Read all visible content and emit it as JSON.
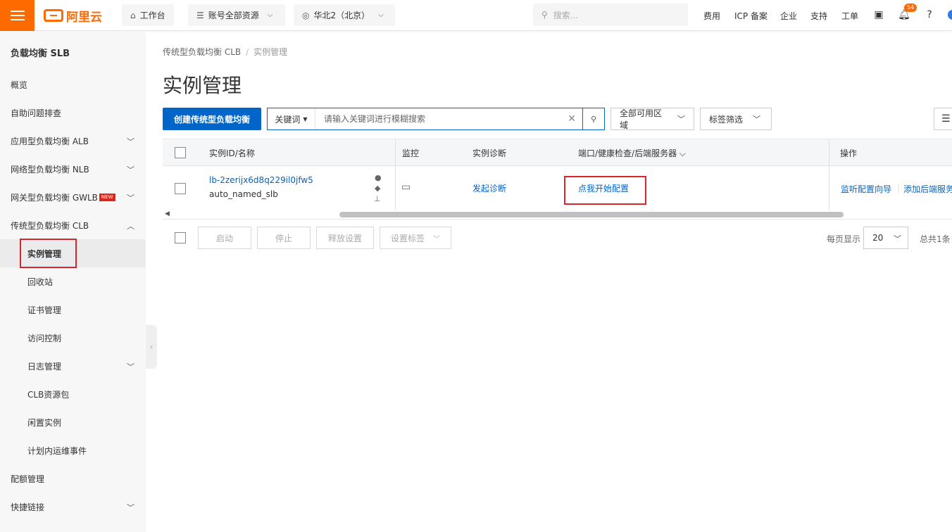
{
  "topbar": {
    "logo_text": "阿里云",
    "workbench": "工作台",
    "account_resources": "账号全部资源",
    "region": "华北2（北京）",
    "search_placeholder": "搜索...",
    "links": [
      "费用",
      "ICP 备案",
      "企业",
      "支持",
      "工单"
    ],
    "notification_count": "54"
  },
  "sidebar": {
    "title": "负载均衡 SLB",
    "items": [
      {
        "label": "概览"
      },
      {
        "label": "自助问题排查"
      },
      {
        "label": "应用型负载均衡 ALB"
      },
      {
        "label": "网络型负载均衡 NLB"
      },
      {
        "label": "网关型负载均衡 GWLB",
        "badge": "NEW"
      },
      {
        "label": "传统型负载均衡 CLB"
      },
      {
        "label": "实例管理"
      },
      {
        "label": "回收站"
      },
      {
        "label": "证书管理"
      },
      {
        "label": "访问控制"
      },
      {
        "label": "日志管理"
      },
      {
        "label": "CLB资源包"
      },
      {
        "label": "闲置实例"
      },
      {
        "label": "计划内运维事件"
      },
      {
        "label": "配额管理"
      },
      {
        "label": "快捷链接"
      }
    ]
  },
  "breadcrumb": [
    "传统型负载均衡 CLB",
    "实例管理"
  ],
  "page_title": "实例管理",
  "toolbar": {
    "create_button": "创建传统型负载均衡",
    "keyword_label": "关键词",
    "search_placeholder": "请输入关键词进行模糊搜索",
    "zone_filter": "全部可用区域",
    "tag_filter": "标签筛选"
  },
  "table": {
    "headers": [
      "实例ID/名称",
      "监控",
      "实例诊断",
      "端口/健康检查/后端服务器",
      "操作"
    ],
    "rows": [
      {
        "instance_id": "lb-2zerijx6d8q229il0jfw5",
        "instance_name": "auto_named_slb",
        "diagnose": "发起诊断",
        "config": "点我开始配置",
        "action_listener": "监听配置向导",
        "action_backend": "添加后端服务器"
      }
    ]
  },
  "footer": {
    "start": "启动",
    "stop": "停止",
    "release": "释放设置",
    "set_tags": "设置标签",
    "per_page_label": "每页显示",
    "per_page_value": "20",
    "total": "总共1条"
  }
}
